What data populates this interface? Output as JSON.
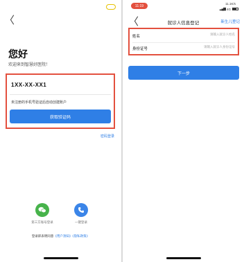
{
  "left": {
    "back_glyph": "〈",
    "greeting": "您好",
    "welcome": "欢迎来到智慧好医院！",
    "phone_value": "1XX-XX-XX1",
    "hint": "未注册的手机号验证后自动创建账户",
    "get_code_button": "获取验证码",
    "password_login": "密码登录",
    "alt_logins": [
      {
        "label": "第三方账号登录",
        "icon": "wechat-icon"
      },
      {
        "label": "一键登录",
        "icon": "phone-icon"
      }
    ],
    "agreement_prefix": "登录即表明同意",
    "agreement_links": [
      "《用户须知》",
      "《隐私政策》"
    ]
  },
  "right": {
    "time": "11:19",
    "speed": "11.1K/s",
    "network": "4G",
    "back_glyph": "〈",
    "title": "就诊人信息登记",
    "new_patient": "新生儿登记",
    "fields": [
      {
        "label": "姓名",
        "placeholder": "请输入就诊人姓名"
      },
      {
        "label": "身份证号",
        "placeholder": "请输入就诊人身份证号"
      }
    ],
    "next_button": "下一步"
  },
  "colors": {
    "accent": "#2f7fe6",
    "highlight_box": "#e3503e",
    "wechat": "#47b34b",
    "phone": "#3b85e8"
  }
}
